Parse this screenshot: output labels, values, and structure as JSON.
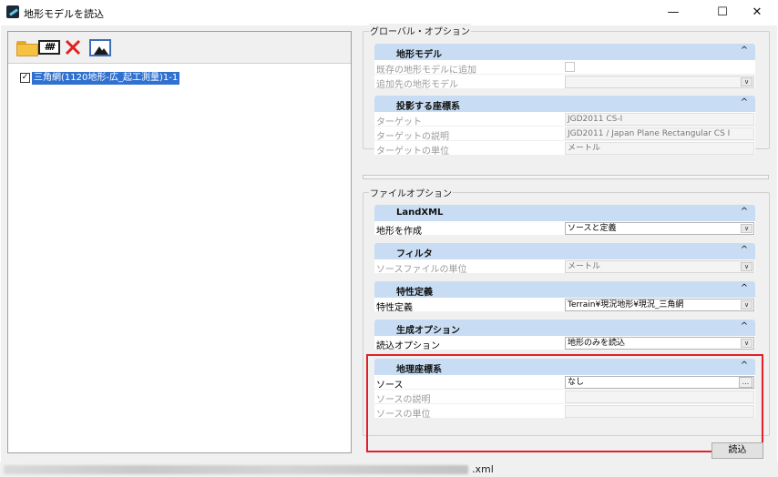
{
  "window": {
    "title": "地形モデルを読込",
    "minimize": "—",
    "maximize": "☐",
    "close": "✕"
  },
  "tree": {
    "item_label": "三角網(1120地形-広_起工測量)1-1",
    "checked": "✓"
  },
  "global_options": {
    "label": "グローバル・オプション",
    "terrain_model": {
      "title": "地形モデル",
      "rows": [
        {
          "label": "既存の地形モデルに追加",
          "value": ""
        },
        {
          "label": "追加先の地形モデル",
          "value": ""
        }
      ]
    },
    "projection": {
      "title": "投影する座標系",
      "rows": [
        {
          "label": "ターゲット",
          "value": "JGD2011 CS-I"
        },
        {
          "label": "ターゲットの説明",
          "value": "JGD2011 / Japan Plane Rectangular CS I"
        },
        {
          "label": "ターゲットの単位",
          "value": "メートル"
        }
      ]
    }
  },
  "file_options": {
    "label": "ファイルオプション",
    "landxml": {
      "title": "LandXML",
      "rows": [
        {
          "label": "地形を作成",
          "value": "ソースと定義"
        }
      ]
    },
    "filter": {
      "title": "フィルタ",
      "rows": [
        {
          "label": "ソースファイルの単位",
          "value": "メートル"
        }
      ]
    },
    "feature_def": {
      "title": "特性定義",
      "rows": [
        {
          "label": "特性定義",
          "value": "Terrain¥現況地形¥現況_三角網"
        }
      ]
    },
    "generation": {
      "title": "生成オプション",
      "rows": [
        {
          "label": "読込オプション",
          "value": "地形のみを読込"
        }
      ]
    },
    "geo_coords": {
      "title": "地理座標系",
      "rows": [
        {
          "label": "ソース",
          "value": "なし"
        },
        {
          "label": "ソースの説明",
          "value": ""
        },
        {
          "label": "ソースの単位",
          "value": ""
        }
      ]
    }
  },
  "common": {
    "chevron": "^",
    "dropdown": "∨",
    "ellipsis": "..."
  },
  "buttons": {
    "import": "読込"
  },
  "status": {
    "filename_suffix": ".xml"
  },
  "colors": {
    "section_header": "#c8ddf3",
    "highlight": "#e0202a",
    "selection": "#3070d0"
  }
}
